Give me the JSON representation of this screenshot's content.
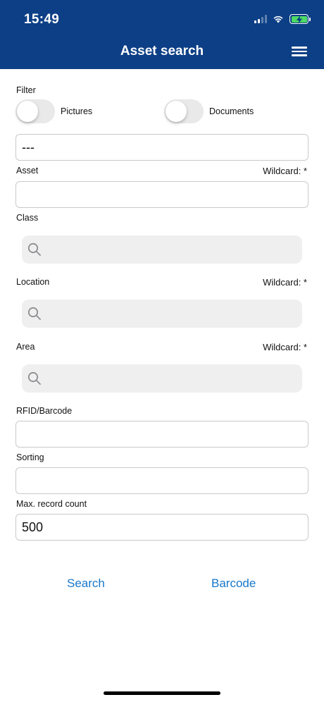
{
  "status_bar": {
    "time": "15:49"
  },
  "header": {
    "title": "Asset search"
  },
  "filter": {
    "label": "Filter",
    "pictures_label": "Pictures",
    "pictures_on": false,
    "documents_label": "Documents",
    "documents_on": false,
    "dropdown_value": "---"
  },
  "asset": {
    "label": "Asset",
    "wildcard": "Wildcard: *",
    "value": ""
  },
  "class": {
    "label": "Class"
  },
  "location": {
    "label": "Location",
    "wildcard": "Wildcard: *"
  },
  "area": {
    "label": "Area",
    "wildcard": "Wildcard: *"
  },
  "rfid": {
    "label": "RFID/Barcode",
    "value": ""
  },
  "sorting": {
    "label": "Sorting",
    "value": ""
  },
  "max_count": {
    "label": "Max. record count",
    "value": "500"
  },
  "actions": {
    "search_label": "Search",
    "barcode_label": "Barcode"
  },
  "colors": {
    "header_bg": "#0c3f86",
    "link": "#1877c9",
    "battery": "#4cd964"
  }
}
